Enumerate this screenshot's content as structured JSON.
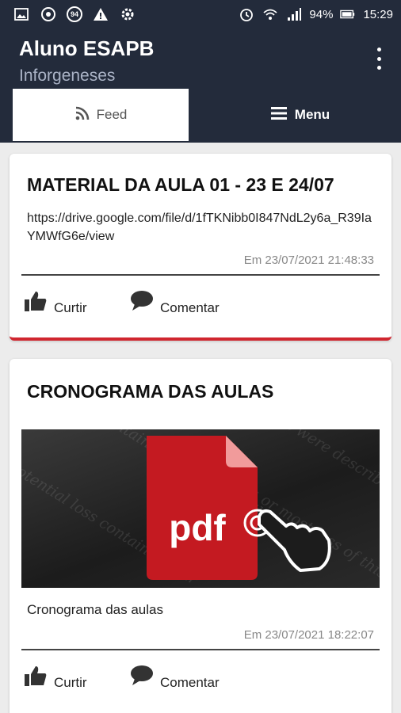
{
  "status_bar": {
    "left_icons": [
      "image-icon",
      "chrome-icon",
      "94-badge-icon",
      "warning-icon",
      "settings-icon"
    ],
    "badge_94": "94",
    "battery": "94%",
    "time": "15:29"
  },
  "app": {
    "title": "Aluno ESAPB",
    "subtitle": "Inforgeneses"
  },
  "tabs": [
    {
      "label": "Feed",
      "icon": "rss-icon",
      "selected": true
    },
    {
      "label": "Menu",
      "icon": "hamburger-icon",
      "selected": false
    }
  ],
  "posts": [
    {
      "title": "MATERIAL DA AULA 01 - 23 E 24/07",
      "link_text": "https://drive.google.com/file/d/1fTKNibb0I847NdL2y6a_R39IaYMWfG6e/view",
      "date": "Em 23/07/2021  21:48:33",
      "like_label": "Curtir",
      "comment_label": "Comentar"
    },
    {
      "title": "CRONOGRAMA DAS AULAS",
      "image_text": "pdf",
      "caption": "Cronograma das aulas",
      "date": "Em 23/07/2021  18:22:07",
      "like_label": "Curtir",
      "comment_label": "Comentar"
    }
  ],
  "colors": {
    "header_bg": "#232b3b",
    "subtitle": "#aab3c6",
    "accent_red": "#d0262f",
    "pdf_red": "#c41a21"
  }
}
